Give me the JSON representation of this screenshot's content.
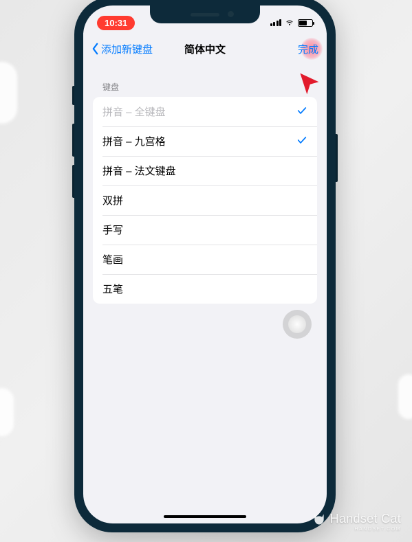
{
  "status_bar": {
    "time": "10:31"
  },
  "nav": {
    "back_label": "添加新键盘",
    "title": "简体中文",
    "done_label": "完成"
  },
  "section": {
    "header": "键盘",
    "rows": [
      {
        "label": "拼音 – 全键盘",
        "selected": true,
        "disabled": true
      },
      {
        "label": "拼音 – 九宫格",
        "selected": true,
        "disabled": false
      },
      {
        "label": "拼音 – 法文键盘",
        "selected": false,
        "disabled": false
      },
      {
        "label": "双拼",
        "selected": false,
        "disabled": false
      },
      {
        "label": "手写",
        "selected": false,
        "disabled": false
      },
      {
        "label": "笔画",
        "selected": false,
        "disabled": false
      },
      {
        "label": "五笔",
        "selected": false,
        "disabled": false
      }
    ]
  },
  "watermark": {
    "title": "Handset Cat",
    "url": "HANDSET.COM"
  }
}
